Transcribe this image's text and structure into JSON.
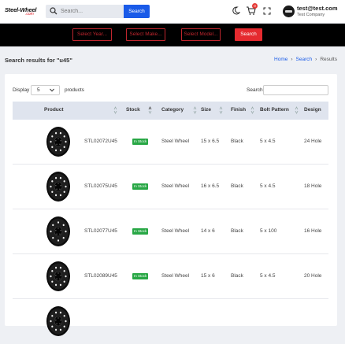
{
  "brand": {
    "logo_word": "Steel-Wheel",
    "logo_sub": ".com",
    "accent": "#e52a2f",
    "primary": "#1a5be8"
  },
  "topbar": {
    "search_placeholder": "Search...",
    "search_button": "Search",
    "cart_count": "0",
    "user_email": "test@test.com",
    "user_company": "Test Company"
  },
  "selector": {
    "year": "Select Year...",
    "make": "Select Make...",
    "model": "Select Model...",
    "search": "Search"
  },
  "page": {
    "title": "Search results for \"u45\"",
    "breadcrumb": [
      "Home",
      "Search",
      "Results"
    ]
  },
  "table_controls": {
    "display_label": "Display",
    "display_value": "5",
    "products_label": "products",
    "search_label": "Search:"
  },
  "table": {
    "columns": [
      "Product",
      "Stock",
      "Category",
      "Size",
      "Finish",
      "Bolt Pattern",
      "Design"
    ],
    "rows": [
      {
        "sku": "STL02072U45",
        "stock": "In Stock",
        "category": "Steel Wheel",
        "size": "15 x 6.5",
        "finish": "Black",
        "bolt": "5 x 4.5",
        "design": "24 Hole"
      },
      {
        "sku": "STL02075U45",
        "stock": "In Stock",
        "category": "Steel Wheel",
        "size": "16 x 6.5",
        "finish": "Black",
        "bolt": "5 x 4.5",
        "design": "18 Hole"
      },
      {
        "sku": "STL02077U45",
        "stock": "In Stock",
        "category": "Steel Wheel",
        "size": "14 x 6",
        "finish": "Black",
        "bolt": "5 x 100",
        "design": "16 Hole"
      },
      {
        "sku": "STL02089U45",
        "stock": "In Stock",
        "category": "Steel Wheel",
        "size": "15 x 6",
        "finish": "Black",
        "bolt": "5 x 4.5",
        "design": "20 Hole"
      }
    ]
  }
}
